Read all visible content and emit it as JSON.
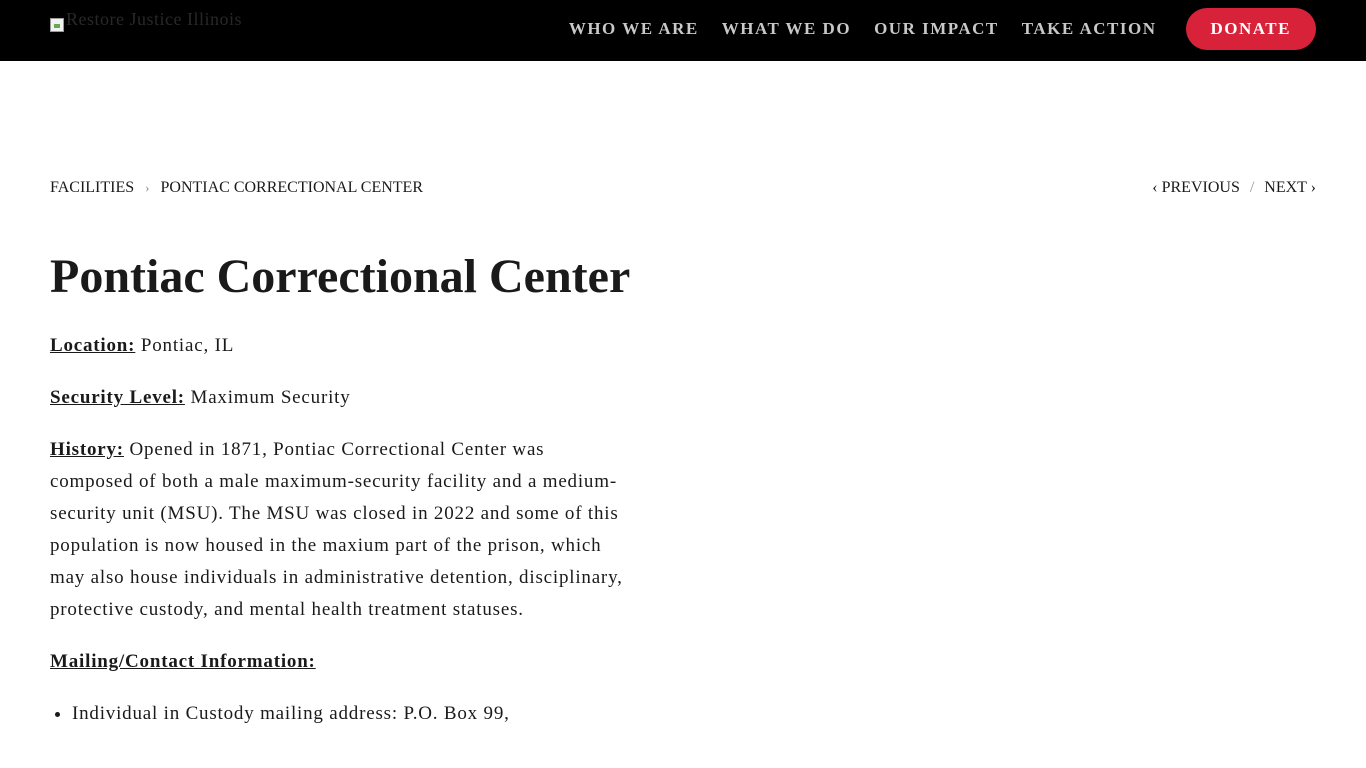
{
  "header": {
    "logo_alt": "Restore Justice Illinois",
    "nav": [
      "WHO WE ARE",
      "WHAT WE DO",
      "OUR IMPACT",
      "TAKE ACTION"
    ],
    "donate_label": "DONATE"
  },
  "breadcrumb": {
    "parent": "FACILITIES",
    "separator": "›",
    "current": "PONTIAC CORRECTIONAL CENTER"
  },
  "pager": {
    "previous": "‹ PREVIOUS",
    "divider": "/",
    "next": "NEXT ›"
  },
  "page": {
    "title": "Pontiac Correctional Center",
    "location_label": "Location:",
    "location_value": "Pontiac, IL",
    "security_label": "Security Level:",
    "security_value": "Maximum Security",
    "history_label": "History:",
    "history_text": "Opened in 1871, Pontiac Correctional Center was composed of both a male maximum-security facility and a medium-security unit (MSU). The MSU was closed in 2022 and some of this population is now housed in the maxium part of the prison, which may also house individuals in administrative detention, disciplinary, protective custody, and mental health treatment statuses.",
    "mailing_label": "Mailing/Contact Information:",
    "mailing_items": [
      "Individual in Custody mailing address: P.O. Box 99,"
    ]
  },
  "colors": {
    "topbar": "#000000",
    "donate": "#d7223a",
    "nav_text": "#c8c8c8"
  }
}
